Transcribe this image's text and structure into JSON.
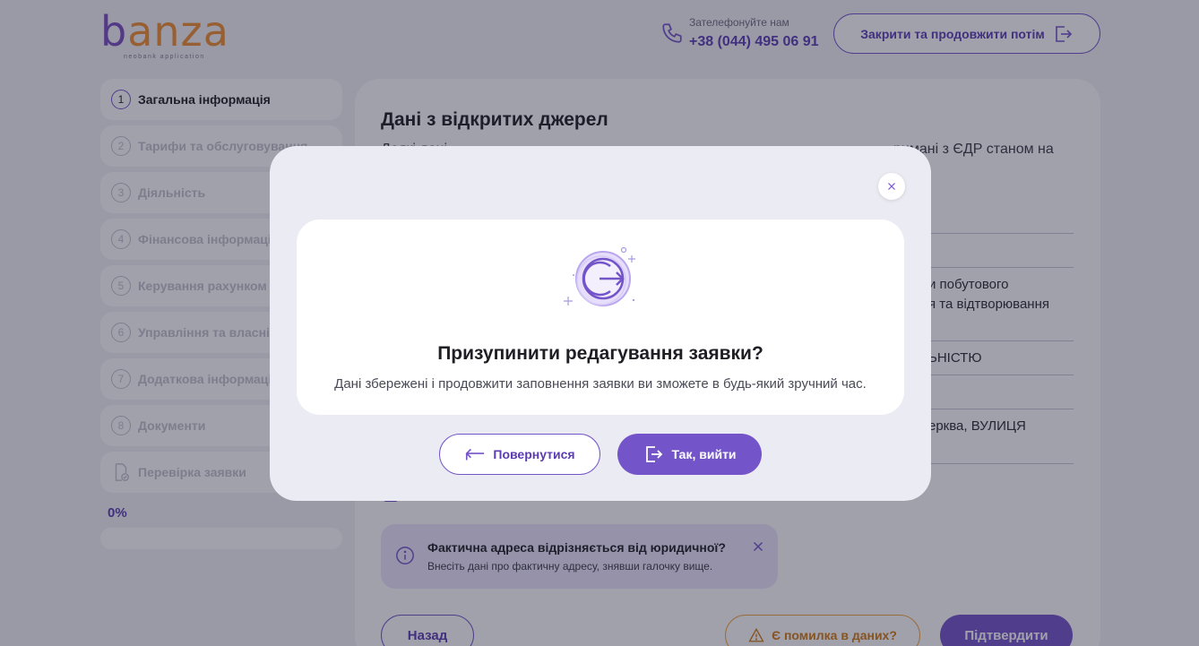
{
  "brand": {
    "logo_text_b": "b",
    "logo_text_rest": "anza",
    "logo_sub": "neobank application",
    "primary_color": "#7454c9",
    "accent_color": "#ef8f2f"
  },
  "header": {
    "phone_hint": "Зателефонуйте нам",
    "phone_number": "+38 (044) 495 06 91",
    "close_button": "Закрити та продовжити потім"
  },
  "sidebar": {
    "steps": [
      {
        "num": "1",
        "label": "Загальна інформація"
      },
      {
        "num": "2",
        "label": "Тарифи та обслуговування"
      },
      {
        "num": "3",
        "label": "Діяльність"
      },
      {
        "num": "4",
        "label": "Фінансова інформація"
      },
      {
        "num": "5",
        "label": "Керування рахунком"
      },
      {
        "num": "6",
        "label": "Управління та власність"
      },
      {
        "num": "7",
        "label": "Додаткова інформація"
      },
      {
        "num": "8",
        "label": "Документи"
      }
    ],
    "review_label": "Перевірка заявки",
    "progress": "0%"
  },
  "main": {
    "title": "Дані з відкритих джерел",
    "subtitle_start": "Деякі дані",
    "subtitle_end": "римані з ЄДР станом на",
    "field_1_line1": "и побутового",
    "field_1_line2": "я та відтворювання",
    "field_2": "ЬНІСТЮ",
    "field_3": "ерква, ВУЛИЦЯ",
    "info_title": "Фактична адреса відрізняється від юридичної?",
    "info_text": "Внесіть дані про фактичну адресу, знявши галочку вище.",
    "back_button": "Назад",
    "error_button": "Є помилка в даних?",
    "confirm_button": "Підтвердити"
  },
  "modal": {
    "title": "Призупинити редагування заявки?",
    "text": "Дані збережені і продовжити заповнення заявки ви зможете в будь-який зручний час.",
    "return_button": "Повернутися",
    "exit_button": "Так, вийти",
    "icon": "exit-door-icon"
  }
}
